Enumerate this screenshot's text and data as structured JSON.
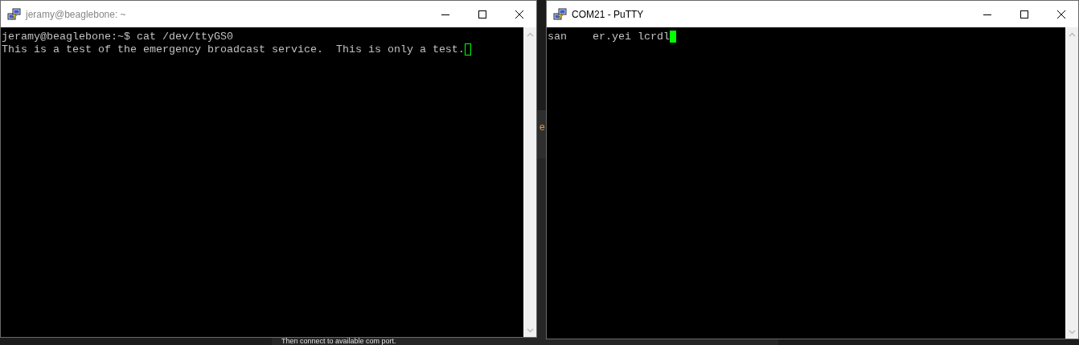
{
  "background_page": {
    "fragment": "e",
    "caption": "Then connect to available com port."
  },
  "windows": [
    {
      "title": "jeramy@beaglebone: ~",
      "active": false,
      "cursor_filled": false,
      "lines": [
        "jeramy@beaglebone:~$ cat /dev/ttyGS0",
        "This is a test of the emergency broadcast service.  This is only a test."
      ]
    },
    {
      "title": "COM21 - PuTTY",
      "active": true,
      "cursor_filled": true,
      "lines": [
        "san    er.yei lcrdl"
      ]
    }
  ]
}
